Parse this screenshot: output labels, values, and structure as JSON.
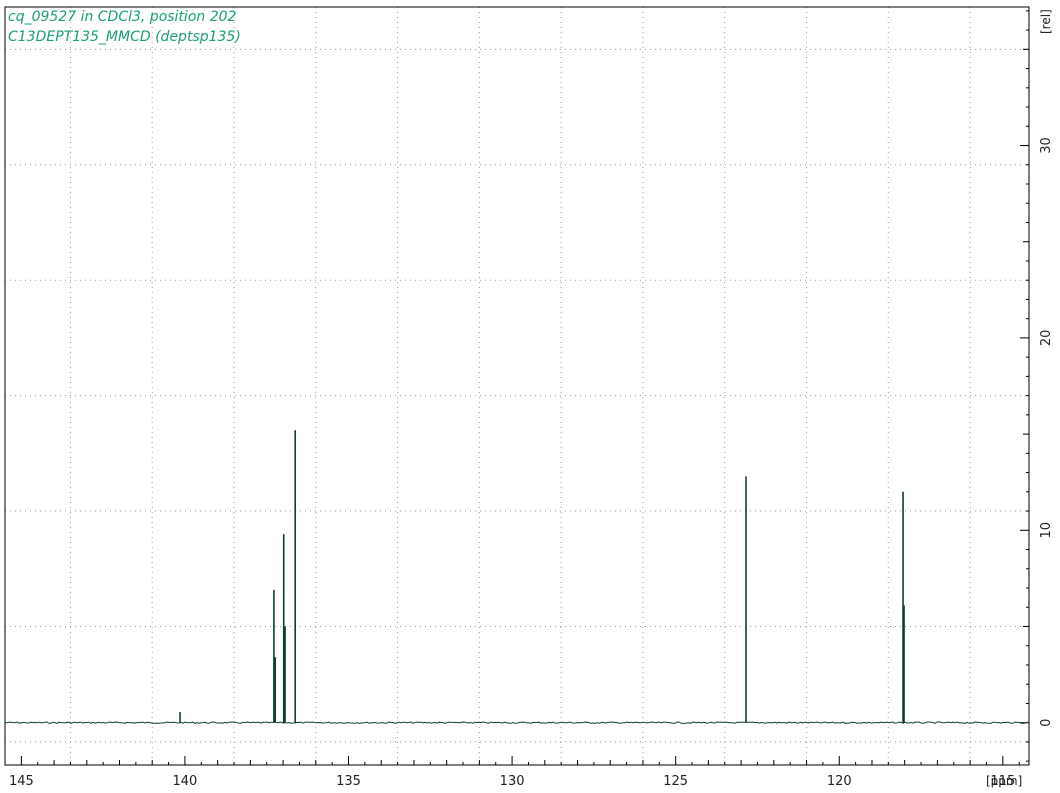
{
  "chart_data": {
    "type": "line",
    "title_lines": [
      "cq_09527 in CDCl3, position 202",
      "C13DEPT135_MMCD (deptsp135)"
    ],
    "xlabel": "[ppm]",
    "ylabel": "[rel]",
    "x_direction": "descending",
    "xlim": [
      145.5,
      114.2
    ],
    "ylim": [
      -2.2,
      37.2
    ],
    "x_ticks": [
      145,
      140,
      135,
      130,
      125,
      120,
      115
    ],
    "y_ticks": [
      0,
      10,
      20,
      30
    ],
    "x_grid": [
      146,
      143.5,
      141,
      138.5,
      136,
      133.5,
      131,
      128.5,
      126,
      123.5,
      121,
      118.5,
      116,
      113.5
    ],
    "y_grid": [
      -1,
      5,
      11,
      17,
      23,
      29,
      35
    ],
    "grid": true,
    "line_color": "#0f3d33",
    "title_color": "#1a9e7a",
    "baseline": 0,
    "series": [
      {
        "peaks": [
          {
            "ppm": 140.15,
            "height": 0.55
          },
          {
            "ppm": 137.28,
            "height": 6.9
          },
          {
            "ppm": 137.24,
            "height": 3.4
          },
          {
            "ppm": 136.98,
            "height": 9.8
          },
          {
            "ppm": 136.94,
            "height": 5.0
          },
          {
            "ppm": 136.63,
            "height": 15.2
          },
          {
            "ppm": 122.85,
            "height": 12.8
          },
          {
            "ppm": 118.05,
            "height": 12.0
          },
          {
            "ppm": 118.02,
            "height": 6.1
          }
        ]
      }
    ]
  }
}
